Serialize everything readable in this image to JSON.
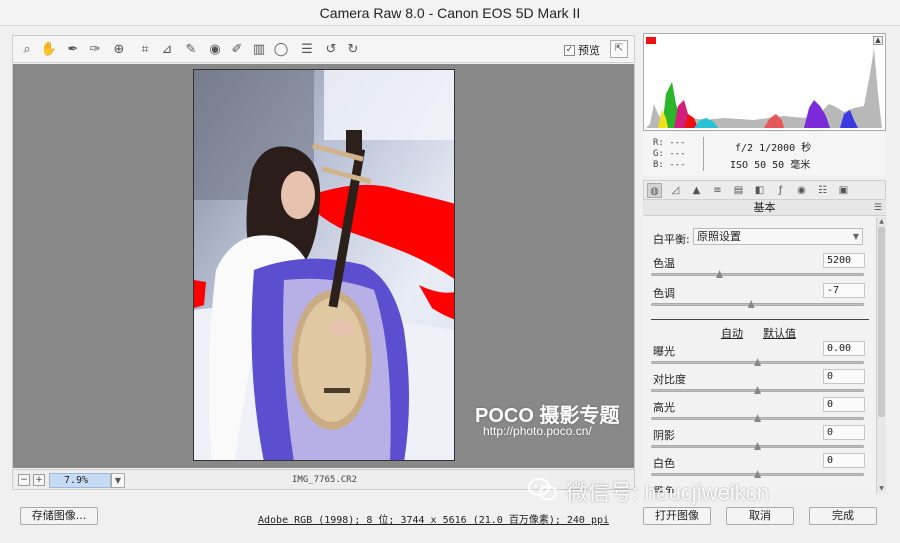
{
  "window": {
    "title": "Camera Raw 8.0 -  Canon EOS 5D Mark II"
  },
  "toolbar": {
    "tools": [
      "zoom-icon",
      "hand-icon",
      "white-balance-icon",
      "color-sampler-icon",
      "target-adjust-icon",
      "crop-icon",
      "straighten-icon",
      "spot-removal-icon",
      "red-eye-icon",
      "adjustment-brush-icon",
      "graduated-filter-icon",
      "radial-filter-icon",
      "preferences-icon",
      "rotate-ccw-icon",
      "rotate-cw-icon"
    ],
    "preview_label": "预览",
    "preview_checked": true
  },
  "zoom": {
    "value": "7.9%",
    "minus": "−",
    "plus": "+"
  },
  "file": {
    "name": "IMG_7765.CR2"
  },
  "footer": {
    "save_label": "存储图像...",
    "workflow": "Adobe RGB (1998); 8 位; 3744 x 5616 (21.0 百万像素); 240 ppi",
    "open_label": "打开图像",
    "cancel_label": "取消",
    "done_label": "完成"
  },
  "info": {
    "r": "R:  ---",
    "g": "G:  ---",
    "b": "B:  ---",
    "exif_line1": "f/2  1/2000 秒",
    "exif_line2": "ISO 50  50 毫米"
  },
  "panel": {
    "section_title": "基本",
    "wb_label": "白平衡:",
    "wb_value": "原照设置",
    "temp": {
      "label": "色温",
      "value": "5200",
      "level": 0.32
    },
    "tint": {
      "label": "色调",
      "value": "-7",
      "level": 0.47
    },
    "auto_label": "自动",
    "default_label": "默认值",
    "exposure": {
      "label": "曝光",
      "value": "0.00",
      "level": 0.5
    },
    "contrast": {
      "label": "对比度",
      "value": "0",
      "level": 0.5
    },
    "highlights": {
      "label": "高光",
      "value": "0",
      "level": 0.5
    },
    "shadows": {
      "label": "阴影",
      "value": "0",
      "level": 0.5
    },
    "whites": {
      "label": "白色",
      "value": "0",
      "level": 0.5
    },
    "blacks": {
      "label": "黑色",
      "value": "",
      "level": 0.5
    }
  },
  "watermark": {
    "brand": "POCO 摄影专题",
    "url": "http://photo.poco.cn/",
    "wechat": "微信号: houcjiweikcn"
  },
  "colors": {
    "clip_warning": "#ff0000",
    "zoom_highlight": "#c7dcf4",
    "canvas_bg": "#898989"
  }
}
